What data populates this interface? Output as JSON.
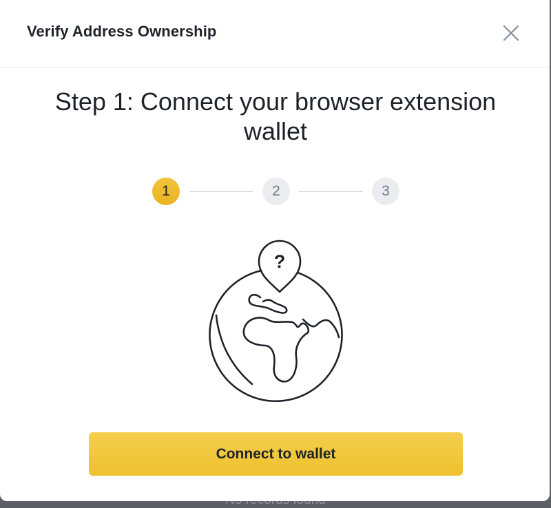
{
  "dialog": {
    "title": "Verify Address Ownership",
    "close_icon": "close-icon"
  },
  "step": {
    "heading": "Step 1: Connect your browser extension wallet",
    "current": 1,
    "steps": [
      {
        "label": "1",
        "state": "active"
      },
      {
        "label": "2",
        "state": "inactive"
      },
      {
        "label": "3",
        "state": "inactive"
      }
    ]
  },
  "illustration": {
    "icon": "globe-question-pin-icon",
    "pin_glyph": "?"
  },
  "actions": {
    "connect_label": "Connect to wallet"
  },
  "background": {
    "partial_text": "No records found"
  },
  "colors": {
    "accent": "#F0B90B",
    "button_top": "#F4CE4C",
    "button_bottom": "#EEC12F",
    "text_primary": "#1E2329",
    "step_inactive_bg": "#EAECEF",
    "step_inactive_text": "#707A8A"
  }
}
